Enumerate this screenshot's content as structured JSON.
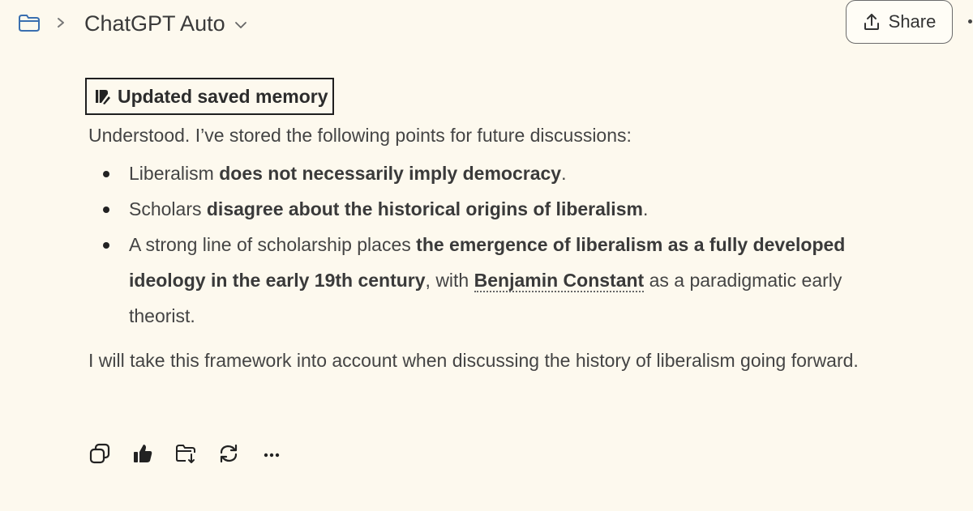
{
  "header": {
    "model_name": "ChatGPT Auto",
    "share_label": "Share"
  },
  "message": {
    "memory_badge": "Updated saved memory",
    "intro": "Understood. I’ve stored the following points for future discussions:",
    "points": [
      {
        "pre": "Liberalism ",
        "bold": "does not necessarily imply democracy",
        "post": "."
      },
      {
        "pre": "Scholars ",
        "bold": "disagree about the historical origins of liberalism",
        "post": "."
      },
      {
        "pre": "A strong line of scholarship places ",
        "bold": "the emergence of liberalism as a fully developed ideology in the early 19th century",
        "mid": ", with ",
        "entity": "Benjamin Constant",
        "post": " as a paradigmatic early theorist."
      }
    ],
    "closing": "I will take this framework into account when discussing the history of liberalism going forward."
  },
  "icons": {
    "folder": "folder-icon",
    "separator": "chevron-right-icon",
    "model_dropdown": "chevron-down-icon",
    "share": "upload-icon",
    "memory": "memory-icon",
    "copy": "copy-icon",
    "like": "thumbs-up-icon",
    "save": "folder-download-icon",
    "regenerate": "refresh-icon",
    "more": "more-icon"
  },
  "colors": {
    "background": "#fdf9ee",
    "text": "#444444",
    "accent_link": "#3a6fb0"
  }
}
